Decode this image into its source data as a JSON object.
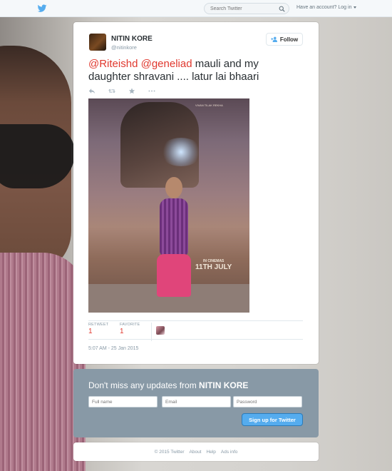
{
  "topbar": {
    "search_placeholder": "Search Twitter",
    "login_prefix": "Have an account?",
    "login_link": "Log in"
  },
  "tweet": {
    "name": "NITIN KORE",
    "handle": "@nitinkore",
    "follow_label": "Follow",
    "mention_1": "@Riteishd",
    "mention_2": "@geneliad",
    "text": " mauli and my daughter shravani .... latur  lai bhaari",
    "photo": {
      "credit": "VIVAN TILAK REKHA",
      "in_cinemas": "IN CINEMAS",
      "release": "11TH JULY"
    },
    "stats": {
      "retweet_label": "RETWEET",
      "retweet_count": "1",
      "favorite_label": "FAVORITE",
      "favorite_count": "1"
    },
    "timestamp": "5:07 AM - 25 Jan 2015"
  },
  "signup": {
    "prefix": "Don't miss any updates from ",
    "name": "NITIN KORE",
    "full_name_placeholder": "Full name",
    "email_placeholder": "Email",
    "password_placeholder": "Password",
    "button_label": "Sign up for Twitter"
  },
  "footer": {
    "copyright": "© 2015 Twitter",
    "about": "About",
    "help": "Help",
    "ads_info": "Ads info"
  },
  "colors": {
    "accent": "#55acee",
    "mention": "#e0382e",
    "signup_bg": "#8899a6"
  },
  "icons": [
    "twitter-bird-icon",
    "search-icon",
    "caret-down-icon",
    "follow-person-icon",
    "reply-icon",
    "retweet-icon",
    "favorite-star-icon",
    "more-icon"
  ]
}
